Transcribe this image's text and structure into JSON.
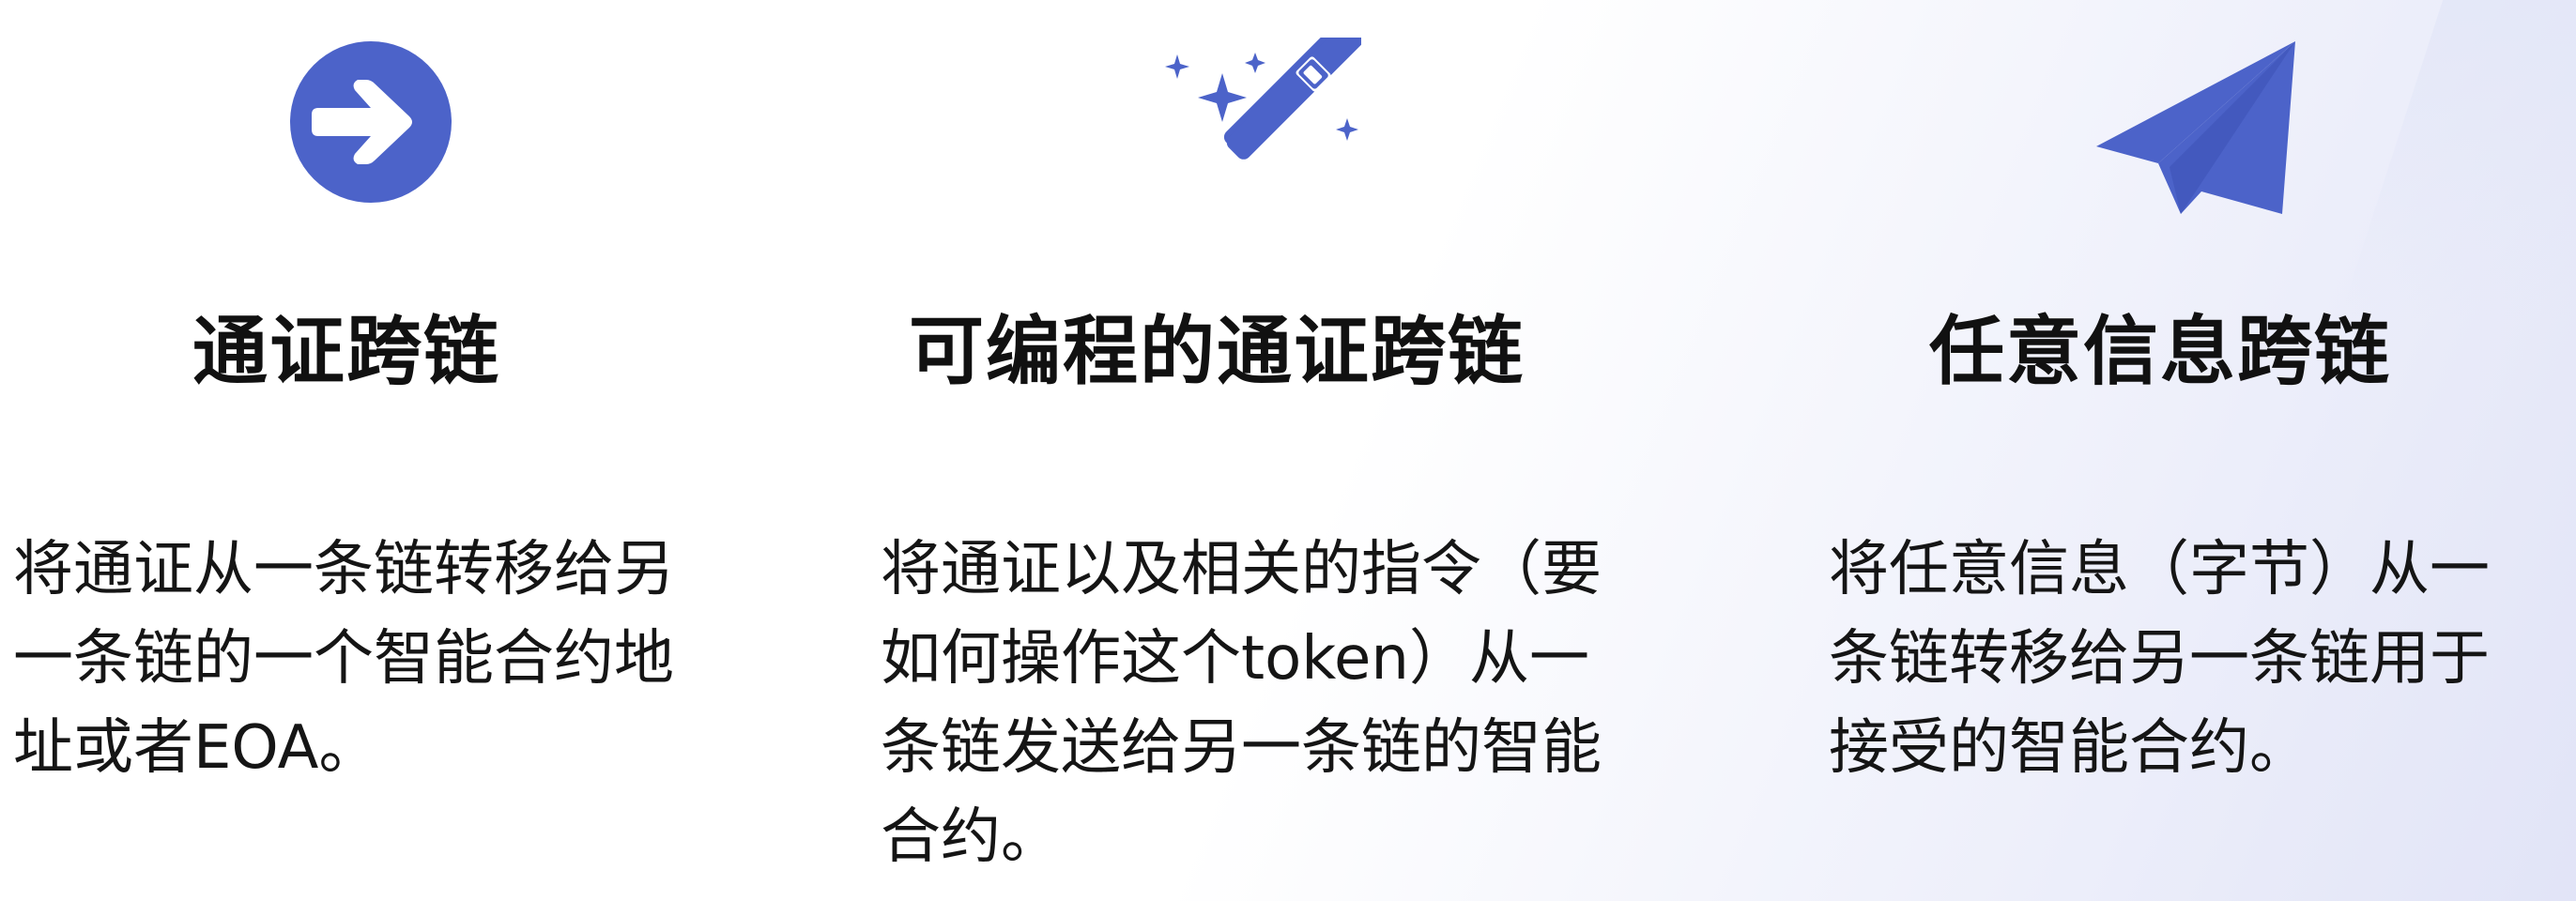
{
  "theme": {
    "accent": "#4c63c9",
    "text": "#111111"
  },
  "features": [
    {
      "icon": "arrow-right-circle-icon",
      "title": "通证跨链",
      "description": "将通证从一条链转移给另\n一条链的一个智能合约地\n址或者EOA。"
    },
    {
      "icon": "magic-wand-icon",
      "title": "可编程的通证跨链",
      "description": "将通证以及相关的指令（要\n如何操作这个token）从一\n条链发送给另一条链的智能\n合约。"
    },
    {
      "icon": "paper-plane-icon",
      "title": "任意信息跨链",
      "description": "将任意信息（字节）从一\n条链转移给另一条链用于\n接受的智能合约。"
    }
  ]
}
